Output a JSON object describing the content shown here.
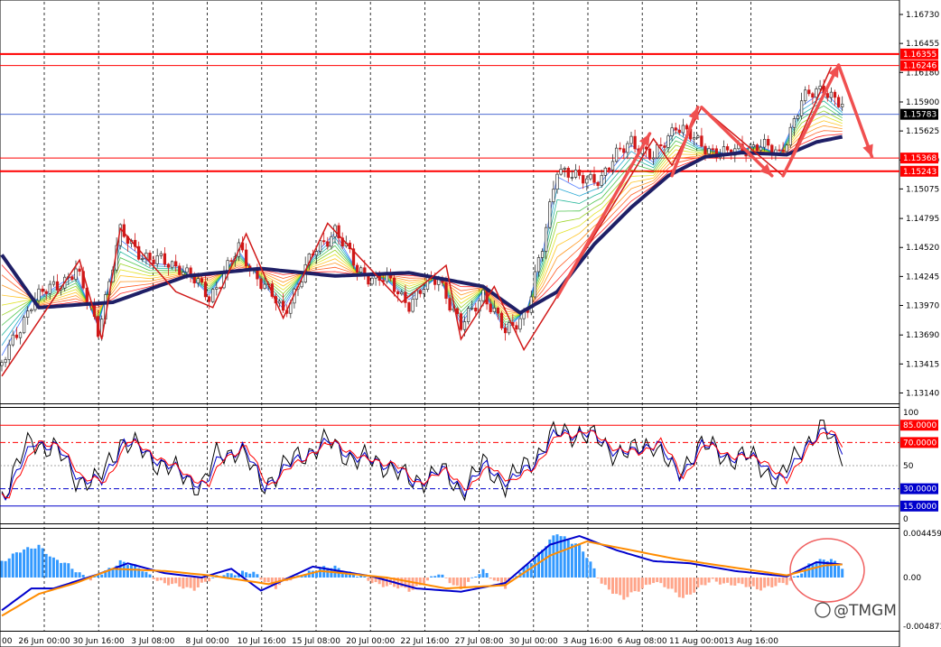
{
  "watermark": "@TMGM",
  "colors": {
    "grid": "#000000",
    "level": "#ff0000",
    "current": "#3355cc",
    "ma": "#1f1f66",
    "bull": "#333333",
    "bear": "#d01818",
    "arrow": "#f05050",
    "hist": "#3399ff",
    "negHist": "#ffa58a",
    "macd": "#0000cc",
    "signal": "#ff8c00",
    "k": "#000000",
    "d": "#0000cc",
    "s": "#ff0000",
    "oversold": "#0000cc"
  },
  "chart_data": [
    {
      "type": "candlestick",
      "title": "",
      "price_ticks": [
        "1.16730",
        "1.16455",
        "1.16180",
        "1.15900",
        "1.15625",
        "1.15350",
        "1.15075",
        "1.14795",
        "1.14520",
        "1.14245",
        "1.13970",
        "1.13690",
        "1.13415",
        "1.13140"
      ],
      "ylim": [
        1.1305,
        1.1685
      ],
      "levels": [
        {
          "label": "1.16355",
          "value": 1.16355
        },
        {
          "label": "1.16246",
          "value": 1.16246
        },
        {
          "label": "1.15368",
          "value": 1.15368
        },
        {
          "label": "1.15243",
          "value": 1.15243
        }
      ],
      "current_price": {
        "label": "1.15783",
        "value": 1.15783
      },
      "x_labels": [
        "00",
        "26 Jun 00:00",
        "30 Jun 16:00",
        "3 Jul 08:00",
        "8 Jul 00:00",
        "10 Jul 16:00",
        "15 Jul 08:00",
        "20 Jul 00:00",
        "22 Jul 16:00",
        "27 Jul 08:00",
        "30 Jul 00:00",
        "3 Aug 16:00",
        "6 Aug 08:00",
        "11 Aug 00:00",
        "13 Aug 16:00"
      ],
      "anchors": [
        {
          "bar": 0,
          "value": 1.134
        },
        {
          "bar": 8,
          "value": 1.14
        },
        {
          "bar": 20,
          "value": 1.143
        },
        {
          "bar": 26,
          "value": 1.1375
        },
        {
          "bar": 32,
          "value": 1.1465
        },
        {
          "bar": 40,
          "value": 1.144
        },
        {
          "bar": 48,
          "value": 1.1435
        },
        {
          "bar": 56,
          "value": 1.1405
        },
        {
          "bar": 64,
          "value": 1.145
        },
        {
          "bar": 72,
          "value": 1.141
        },
        {
          "bar": 76,
          "value": 1.139
        },
        {
          "bar": 84,
          "value": 1.1445
        },
        {
          "bar": 90,
          "value": 1.147
        },
        {
          "bar": 96,
          "value": 1.143
        },
        {
          "bar": 104,
          "value": 1.142
        },
        {
          "bar": 110,
          "value": 1.14
        },
        {
          "bar": 118,
          "value": 1.1425
        },
        {
          "bar": 124,
          "value": 1.1375
        },
        {
          "bar": 130,
          "value": 1.141
        },
        {
          "bar": 136,
          "value": 1.137
        },
        {
          "bar": 142,
          "value": 1.1395
        },
        {
          "bar": 146,
          "value": 1.145
        },
        {
          "bar": 150,
          "value": 1.153
        },
        {
          "bar": 156,
          "value": 1.1515
        },
        {
          "bar": 162,
          "value": 1.152
        },
        {
          "bar": 170,
          "value": 1.1555
        },
        {
          "bar": 176,
          "value": 1.1535
        },
        {
          "bar": 182,
          "value": 1.157
        },
        {
          "bar": 188,
          "value": 1.155
        },
        {
          "bar": 196,
          "value": 1.154
        },
        {
          "bar": 204,
          "value": 1.155
        },
        {
          "bar": 210,
          "value": 1.154
        },
        {
          "bar": 216,
          "value": 1.159
        },
        {
          "bar": 222,
          "value": 1.1605
        },
        {
          "bar": 227,
          "value": 1.1585
        }
      ],
      "ma_anchors": [
        {
          "bar": 0,
          "value": 1.1445
        },
        {
          "bar": 10,
          "value": 1.1395
        },
        {
          "bar": 30,
          "value": 1.14
        },
        {
          "bar": 50,
          "value": 1.1425
        },
        {
          "bar": 70,
          "value": 1.1432
        },
        {
          "bar": 90,
          "value": 1.1425
        },
        {
          "bar": 110,
          "value": 1.1428
        },
        {
          "bar": 130,
          "value": 1.1415
        },
        {
          "bar": 140,
          "value": 1.139
        },
        {
          "bar": 150,
          "value": 1.141
        },
        {
          "bar": 160,
          "value": 1.1455
        },
        {
          "bar": 170,
          "value": 1.149
        },
        {
          "bar": 180,
          "value": 1.152
        },
        {
          "bar": 190,
          "value": 1.1538
        },
        {
          "bar": 200,
          "value": 1.1542
        },
        {
          "bar": 212,
          "value": 1.154
        },
        {
          "bar": 220,
          "value": 1.1552
        },
        {
          "bar": 227,
          "value": 1.1557
        }
      ],
      "zigzag": [
        {
          "bar": 0,
          "value": 1.133
        },
        {
          "bar": 21,
          "value": 1.144
        },
        {
          "bar": 27,
          "value": 1.1365
        },
        {
          "bar": 32,
          "value": 1.147
        },
        {
          "bar": 47,
          "value": 1.141
        },
        {
          "bar": 57,
          "value": 1.1395
        },
        {
          "bar": 66,
          "value": 1.1465
        },
        {
          "bar": 76,
          "value": 1.1385
        },
        {
          "bar": 88,
          "value": 1.1475
        },
        {
          "bar": 108,
          "value": 1.14
        },
        {
          "bar": 120,
          "value": 1.1435
        },
        {
          "bar": 124,
          "value": 1.1365
        },
        {
          "bar": 133,
          "value": 1.1415
        },
        {
          "bar": 141,
          "value": 1.1355
        },
        {
          "bar": 149,
          "value": 1.14
        },
        {
          "bar": 176,
          "value": 1.1555
        },
        {
          "bar": 181,
          "value": 1.153
        },
        {
          "bar": 189,
          "value": 1.1585
        },
        {
          "bar": 211,
          "value": 1.152
        },
        {
          "bar": 224,
          "value": 1.1623
        }
      ],
      "arrows": [
        {
          "from": {
            "bar": 150,
            "value": 1.1405
          },
          "to": {
            "bar": 175,
            "value": 1.156
          }
        },
        {
          "from": {
            "bar": 181,
            "value": 1.152
          },
          "to": {
            "bar": 188,
            "value": 1.1585
          }
        },
        {
          "from": {
            "bar": 189,
            "value": 1.1585
          },
          "to": {
            "bar": 208,
            "value": 1.152
          }
        },
        {
          "from": {
            "bar": 211,
            "value": 1.152
          },
          "to": {
            "bar": 226,
            "value": 1.1625
          }
        },
        {
          "from": {
            "bar": 226,
            "value": 1.1625
          },
          "to": {
            "bar": 235,
            "value": 1.1538
          }
        }
      ]
    },
    {
      "type": "line",
      "indicator": "stochastic",
      "ylim": [
        0,
        100
      ],
      "levels": [
        {
          "label": "85.0000",
          "value": 85
        },
        {
          "label": "70.0000",
          "value": 70
        },
        {
          "label": "30.0000",
          "value": 30
        },
        {
          "label": "15.0000",
          "value": 15
        }
      ],
      "tick_labels": [
        {
          "label": "100",
          "value": 100
        },
        {
          "label": "50",
          "value": 50
        },
        {
          "label": "0",
          "value": 0
        }
      ],
      "anchors": [
        {
          "bar": 0,
          "value": 25
        },
        {
          "bar": 8,
          "value": 72
        },
        {
          "bar": 14,
          "value": 65
        },
        {
          "bar": 20,
          "value": 40
        },
        {
          "bar": 26,
          "value": 35
        },
        {
          "bar": 32,
          "value": 72
        },
        {
          "bar": 40,
          "value": 58
        },
        {
          "bar": 48,
          "value": 42
        },
        {
          "bar": 54,
          "value": 33
        },
        {
          "bar": 58,
          "value": 57
        },
        {
          "bar": 64,
          "value": 66
        },
        {
          "bar": 70,
          "value": 33
        },
        {
          "bar": 76,
          "value": 48
        },
        {
          "bar": 82,
          "value": 62
        },
        {
          "bar": 88,
          "value": 70
        },
        {
          "bar": 96,
          "value": 55
        },
        {
          "bar": 104,
          "value": 52
        },
        {
          "bar": 110,
          "value": 35
        },
        {
          "bar": 118,
          "value": 45
        },
        {
          "bar": 124,
          "value": 30
        },
        {
          "bar": 130,
          "value": 50
        },
        {
          "bar": 136,
          "value": 35
        },
        {
          "bar": 142,
          "value": 50
        },
        {
          "bar": 148,
          "value": 75
        },
        {
          "bar": 156,
          "value": 80
        },
        {
          "bar": 164,
          "value": 65
        },
        {
          "bar": 170,
          "value": 60
        },
        {
          "bar": 176,
          "value": 72
        },
        {
          "bar": 182,
          "value": 40
        },
        {
          "bar": 188,
          "value": 68
        },
        {
          "bar": 196,
          "value": 58
        },
        {
          "bar": 204,
          "value": 55
        },
        {
          "bar": 210,
          "value": 35
        },
        {
          "bar": 216,
          "value": 68
        },
        {
          "bar": 222,
          "value": 80
        },
        {
          "bar": 227,
          "value": 63
        }
      ]
    },
    {
      "type": "bar",
      "indicator": "macd",
      "ylim": [
        -0.004873,
        0.004459
      ],
      "tick_labels": [
        {
          "label": "0.0044593",
          "value": 0.0044593
        },
        {
          "label": "0.00",
          "value": 0
        },
        {
          "label": "-0.004873",
          "value": -0.004873
        }
      ],
      "anchors": [
        {
          "bar": 0,
          "value": 0.0015
        },
        {
          "bar": 6,
          "value": 0.0025
        },
        {
          "bar": 10,
          "value": 0.003
        },
        {
          "bar": 14,
          "value": 0.0016
        },
        {
          "bar": 18,
          "value": 0.0012
        },
        {
          "bar": 24,
          "value": -0.0003
        },
        {
          "bar": 32,
          "value": 0.0015
        },
        {
          "bar": 38,
          "value": 0.0007
        },
        {
          "bar": 44,
          "value": -0.0006
        },
        {
          "bar": 52,
          "value": -0.001
        },
        {
          "bar": 60,
          "value": 0.0004
        },
        {
          "bar": 68,
          "value": 0.0004
        },
        {
          "bar": 74,
          "value": -0.0009
        },
        {
          "bar": 82,
          "value": 0.0005
        },
        {
          "bar": 90,
          "value": 0.001
        },
        {
          "bar": 100,
          "value": -0.0004
        },
        {
          "bar": 110,
          "value": -0.0012
        },
        {
          "bar": 118,
          "value": 0.0003
        },
        {
          "bar": 124,
          "value": -0.001
        },
        {
          "bar": 130,
          "value": 0.0006
        },
        {
          "bar": 136,
          "value": -0.0009
        },
        {
          "bar": 142,
          "value": 0.0012
        },
        {
          "bar": 150,
          "value": 0.004
        },
        {
          "bar": 156,
          "value": 0.003
        },
        {
          "bar": 162,
          "value": -0.0005
        },
        {
          "bar": 168,
          "value": -0.002
        },
        {
          "bar": 176,
          "value": -0.0003
        },
        {
          "bar": 184,
          "value": -0.0018
        },
        {
          "bar": 192,
          "value": -0.0003
        },
        {
          "bar": 204,
          "value": -0.001
        },
        {
          "bar": 212,
          "value": -0.0006
        },
        {
          "bar": 218,
          "value": 0.0012
        },
        {
          "bar": 224,
          "value": 0.0017
        },
        {
          "bar": 227,
          "value": 0.001
        }
      ],
      "macd_anchors": [
        {
          "bar": 0,
          "value": -0.003
        },
        {
          "bar": 8,
          "value": -0.001
        },
        {
          "bar": 14,
          "value": -0.001
        },
        {
          "bar": 26,
          "value": 0.0003
        },
        {
          "bar": 34,
          "value": 0.0013
        },
        {
          "bar": 44,
          "value": 0.0004
        },
        {
          "bar": 54,
          "value": 0.0
        },
        {
          "bar": 62,
          "value": 0.0008
        },
        {
          "bar": 70,
          "value": -0.0012
        },
        {
          "bar": 84,
          "value": 0.001
        },
        {
          "bar": 100,
          "value": 0.0001
        },
        {
          "bar": 112,
          "value": -0.001
        },
        {
          "bar": 124,
          "value": -0.0013
        },
        {
          "bar": 136,
          "value": -0.0005
        },
        {
          "bar": 148,
          "value": 0.003
        },
        {
          "bar": 156,
          "value": 0.0038
        },
        {
          "bar": 166,
          "value": 0.0025
        },
        {
          "bar": 176,
          "value": 0.0015
        },
        {
          "bar": 186,
          "value": 0.0013
        },
        {
          "bar": 198,
          "value": 0.0006
        },
        {
          "bar": 212,
          "value": 0.0001
        },
        {
          "bar": 220,
          "value": 0.0014
        },
        {
          "bar": 227,
          "value": 0.0012
        }
      ],
      "signal_anchors": [
        {
          "bar": 0,
          "value": -0.0035
        },
        {
          "bar": 10,
          "value": -0.0015
        },
        {
          "bar": 20,
          "value": -0.0005
        },
        {
          "bar": 30,
          "value": 0.0008
        },
        {
          "bar": 44,
          "value": 0.0006
        },
        {
          "bar": 56,
          "value": 0.0002
        },
        {
          "bar": 72,
          "value": -0.0006
        },
        {
          "bar": 86,
          "value": 0.0006
        },
        {
          "bar": 104,
          "value": 0.0
        },
        {
          "bar": 120,
          "value": -0.001
        },
        {
          "bar": 136,
          "value": -0.0007
        },
        {
          "bar": 148,
          "value": 0.002
        },
        {
          "bar": 158,
          "value": 0.0033
        },
        {
          "bar": 170,
          "value": 0.0025
        },
        {
          "bar": 182,
          "value": 0.0017
        },
        {
          "bar": 196,
          "value": 0.001
        },
        {
          "bar": 212,
          "value": 0.0002
        },
        {
          "bar": 222,
          "value": 0.0011
        },
        {
          "bar": 227,
          "value": 0.0012
        }
      ]
    }
  ]
}
